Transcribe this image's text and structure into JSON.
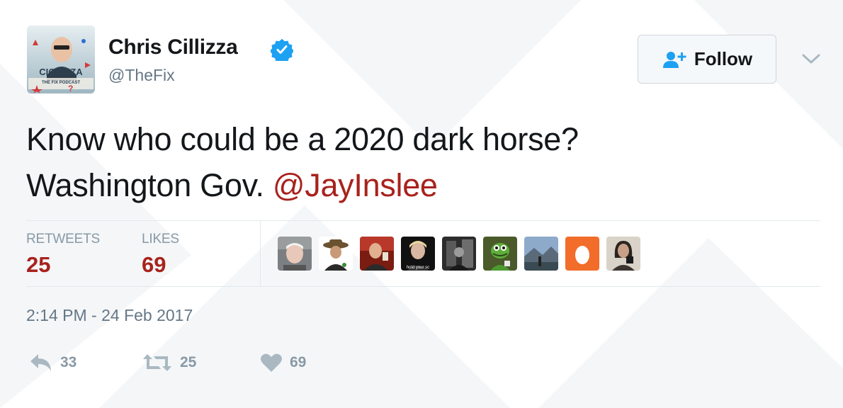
{
  "author": {
    "name": "Chris Cillizza",
    "handle": "@TheFix",
    "verified_icon": "verified-badge-icon",
    "avatar_text": {
      "title": "CIQUIZZA",
      "subtitle": "THE FIX PODCAST"
    }
  },
  "follow_button": {
    "label": "Follow",
    "icon": "add-user-icon"
  },
  "menu_icon": "chevron-down-icon",
  "tweet": {
    "text_line1": "Know who could be a 2020 dark horse?",
    "text_line2_prefix": "Washington Gov. ",
    "mention": "@JayInslee"
  },
  "stats": {
    "retweets_label": "RETWEETS",
    "retweets_value": "25",
    "likes_label": "LIKES",
    "likes_value": "69"
  },
  "likers": [
    {
      "name": "liker-avatar-1"
    },
    {
      "name": "liker-avatar-2"
    },
    {
      "name": "liker-avatar-3"
    },
    {
      "name": "liker-avatar-4",
      "caption": "hold your sc"
    },
    {
      "name": "liker-avatar-5"
    },
    {
      "name": "liker-avatar-6"
    },
    {
      "name": "liker-avatar-7"
    },
    {
      "name": "liker-avatar-8"
    },
    {
      "name": "liker-avatar-9"
    }
  ],
  "timestamp": "2:14 PM - 24 Feb 2017",
  "actions": {
    "reply_count": "33",
    "retweet_count": "25",
    "like_count": "69"
  },
  "colors": {
    "mention": "#a8221d",
    "stat_value": "#a8221d",
    "verified": "#1da1f2",
    "follow_icon": "#1da1f2",
    "muted": "#8899a6"
  }
}
